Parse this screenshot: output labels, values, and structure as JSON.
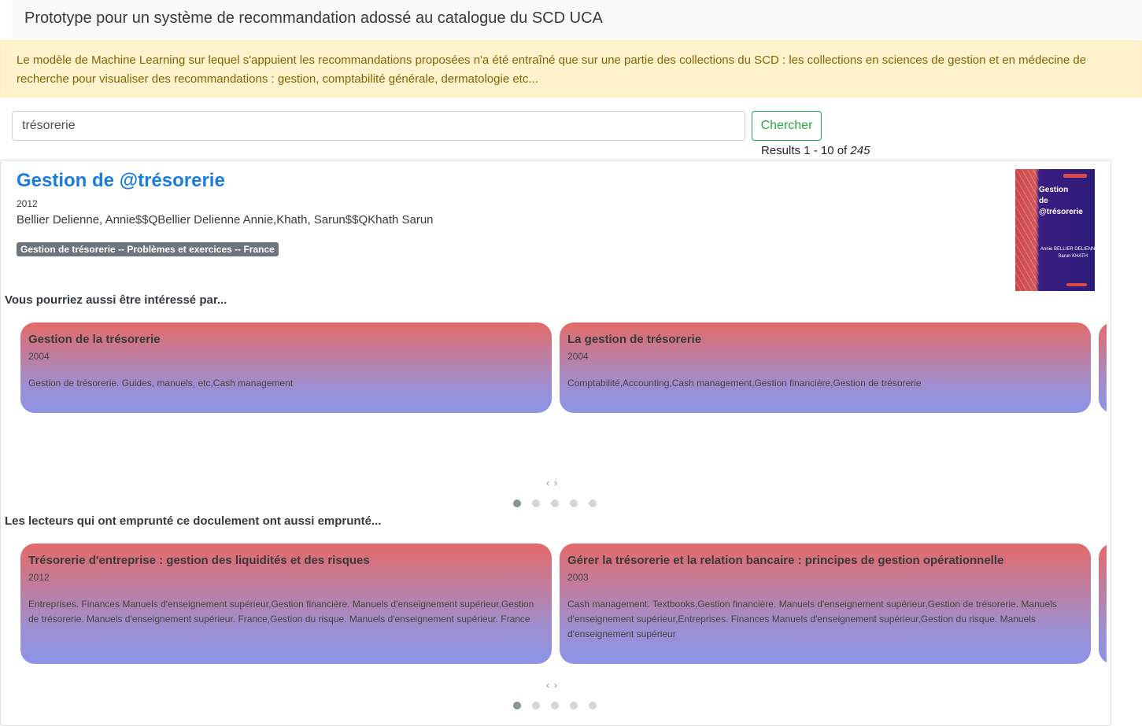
{
  "app_title": "Prototype pour un système de recommandation adossé au catalogue du SCD UCA",
  "alert": {
    "line1": "Le modèle de Machine Learning sur lequel s'appuient les recommandations proposées n'a été entraîné que sur une partie des collections du SCD : les collections en sciences de gestion et en médecine de",
    "line2": "recherche pour visualiser des recommandations : gestion, comptabilité générale, dermatologie etc..."
  },
  "search": {
    "value": "trésorerie",
    "button_label": "Chercher"
  },
  "results": {
    "prefix": "Results 1 - 10 of ",
    "total": "245"
  },
  "document": {
    "title": "Gestion de @trésorerie",
    "year": "2012",
    "authors": "Bellier Delienne, Annie$$QBellier Delienne Annie,Khath, Sarun$$QKhath Sarun",
    "subject_badge": "Gestion de trésorerie -- Problèmes et exercices -- France",
    "cover": {
      "title": "Gestion\nde\n@trésorerie",
      "authors": "Annie BELLIER DELIENNE\nSarun KHATH"
    }
  },
  "similar": {
    "heading": "Vous pourriez aussi être intéressé par...",
    "nav_prev": "‹",
    "nav_next": "›",
    "items": [
      {
        "title": "Gestion de la trésorerie",
        "year": "2004",
        "subjects": "Gestion de trésorerie. Guides, manuels, etc,Cash management"
      },
      {
        "title": "La gestion de trésorerie",
        "year": "2004",
        "subjects": "Comptabilité,Accounting,Cash management,Gestion financière,Gestion de trésorerie"
      }
    ],
    "dots_count": 5,
    "active_dot": 0
  },
  "borrowed": {
    "heading": "Les lecteurs qui ont emprunté ce doculement ont aussi emprunté...",
    "nav_prev": "‹",
    "nav_next": "›",
    "items": [
      {
        "title": "Trésorerie d'entreprise : gestion des liquidités et des risques",
        "year": "2012",
        "subjects": "Entreprises. Finances Manuels d'enseignement supérieur,Gestion financière. Manuels d'enseignement supérieur,Gestion de trésorerie. Manuels d'enseignement supérieur. France,Gestion du risque. Manuels d'enseignement supérieur. France"
      },
      {
        "title": "Gérer la trésorerie et la relation bancaire : principes de gestion opérationnelle",
        "year": "2003",
        "subjects": "Cash management. Textbooks,Gestion financière. Manuels d'enseignement supérieur,Gestion de trésorerie. Manuels d'enseignement supérieur,Entreprises. Finances Manuels d'enseignement supérieur,Gestion du risque. Manuels d'enseignement supérieur"
      }
    ],
    "dots_count": 5,
    "active_dot": 0
  }
}
